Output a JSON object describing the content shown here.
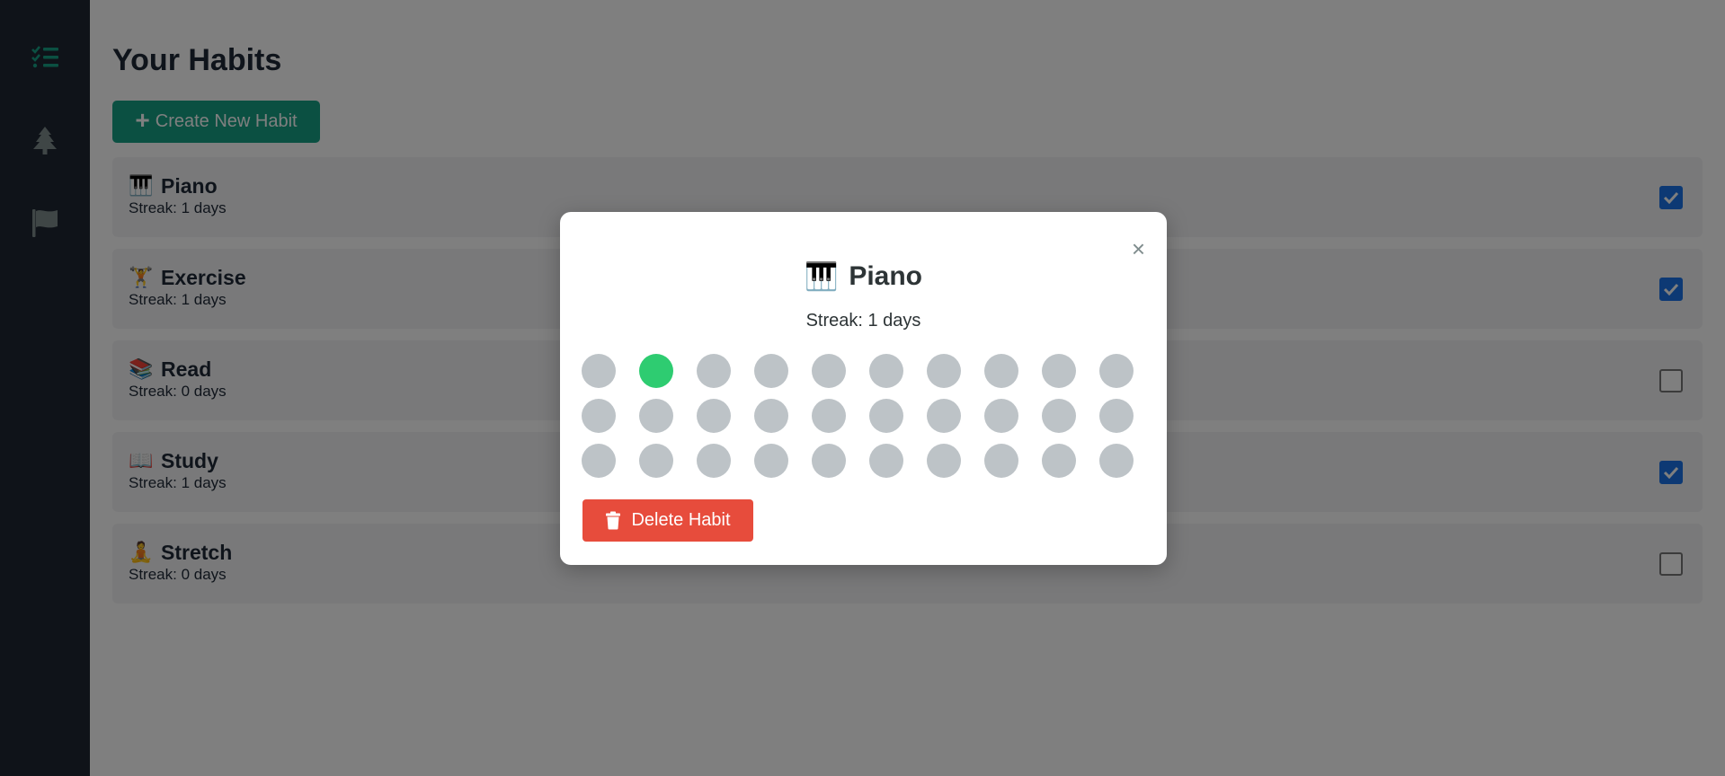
{
  "sidebar": {
    "items": [
      {
        "name": "habits",
        "icon": "list-check-icon",
        "color": "#16a085"
      },
      {
        "name": "tree",
        "icon": "tree-icon",
        "color": "#7f8c8d"
      },
      {
        "name": "goals",
        "icon": "flag-icon",
        "color": "#7f8c8d"
      }
    ]
  },
  "main": {
    "title": "Your Habits",
    "create_button": {
      "icon": "+",
      "label": "Create New Habit"
    }
  },
  "habits": [
    {
      "emoji": "🎹",
      "name": "Piano",
      "streak": "Streak: 1 days",
      "checked": true
    },
    {
      "emoji": "🏋️",
      "name": "Exercise",
      "streak": "Streak: 1 days",
      "checked": true
    },
    {
      "emoji": "📚",
      "name": "Read",
      "streak": "Streak: 0 days",
      "checked": false
    },
    {
      "emoji": "📖",
      "name": "Study",
      "streak": "Streak: 1 days",
      "checked": true
    },
    {
      "emoji": "🧘",
      "name": "Stretch",
      "streak": "Streak: 0 days",
      "checked": false
    }
  ],
  "modal": {
    "close": "×",
    "emoji": "🎹",
    "title": "Piano",
    "streak": "Streak: 1 days",
    "grid_days": [
      0,
      1,
      0,
      0,
      0,
      0,
      0,
      0,
      0,
      0,
      0,
      0,
      0,
      0,
      0,
      0,
      0,
      0,
      0,
      0,
      0,
      0,
      0,
      0,
      0,
      0,
      0,
      0,
      0,
      0
    ],
    "delete_label": "Delete Habit"
  },
  "colors": {
    "accent": "#16a085",
    "danger": "#e74c3c",
    "done_dot": "#2ecc71",
    "empty_dot": "#bdc3c7",
    "checkbox": "#1a73e8"
  }
}
